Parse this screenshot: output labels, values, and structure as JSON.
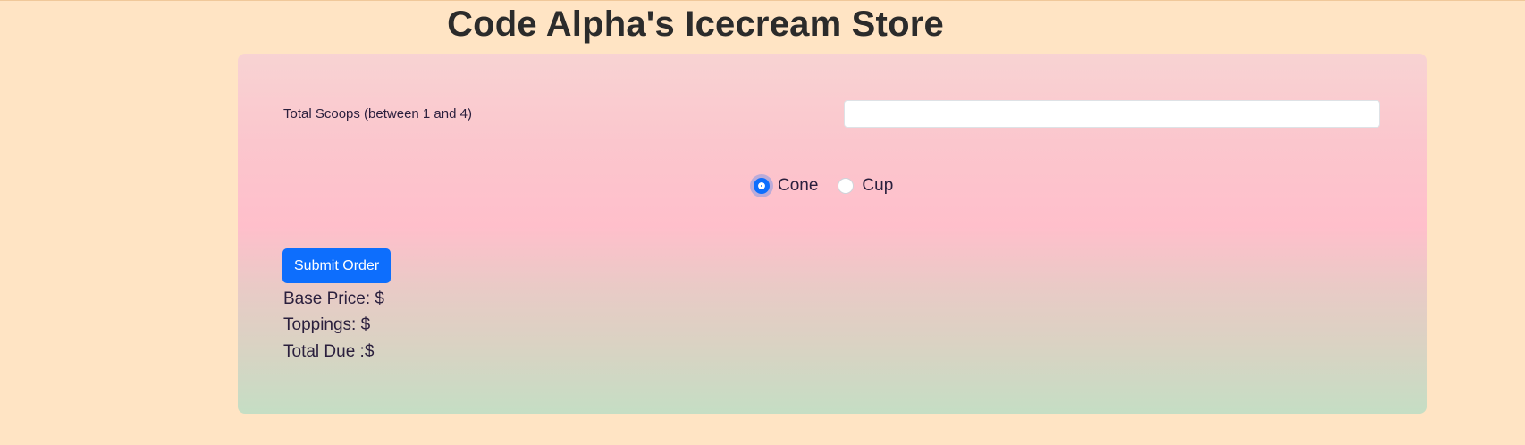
{
  "header": {
    "title": "Code Alpha's Icecream Store"
  },
  "form": {
    "scoops_label": "Total Scoops (between 1 and 4)",
    "scoops_value": "",
    "scoops_placeholder": "",
    "container_options": [
      {
        "label": "Cone",
        "checked": true
      },
      {
        "label": "Cup",
        "checked": false
      }
    ],
    "submit_label": "Submit Order"
  },
  "summary": {
    "base_price": "Base Price: $",
    "toppings": "Toppings: $",
    "total_due": "Total Due :$"
  },
  "colors": {
    "page_background": "#ffe4c4",
    "accent": "#0d6efd",
    "card_gradient_top": "#f8d3d3",
    "card_gradient_middle": "#ffbfcb",
    "card_gradient_bottom": "#c5dec4"
  }
}
